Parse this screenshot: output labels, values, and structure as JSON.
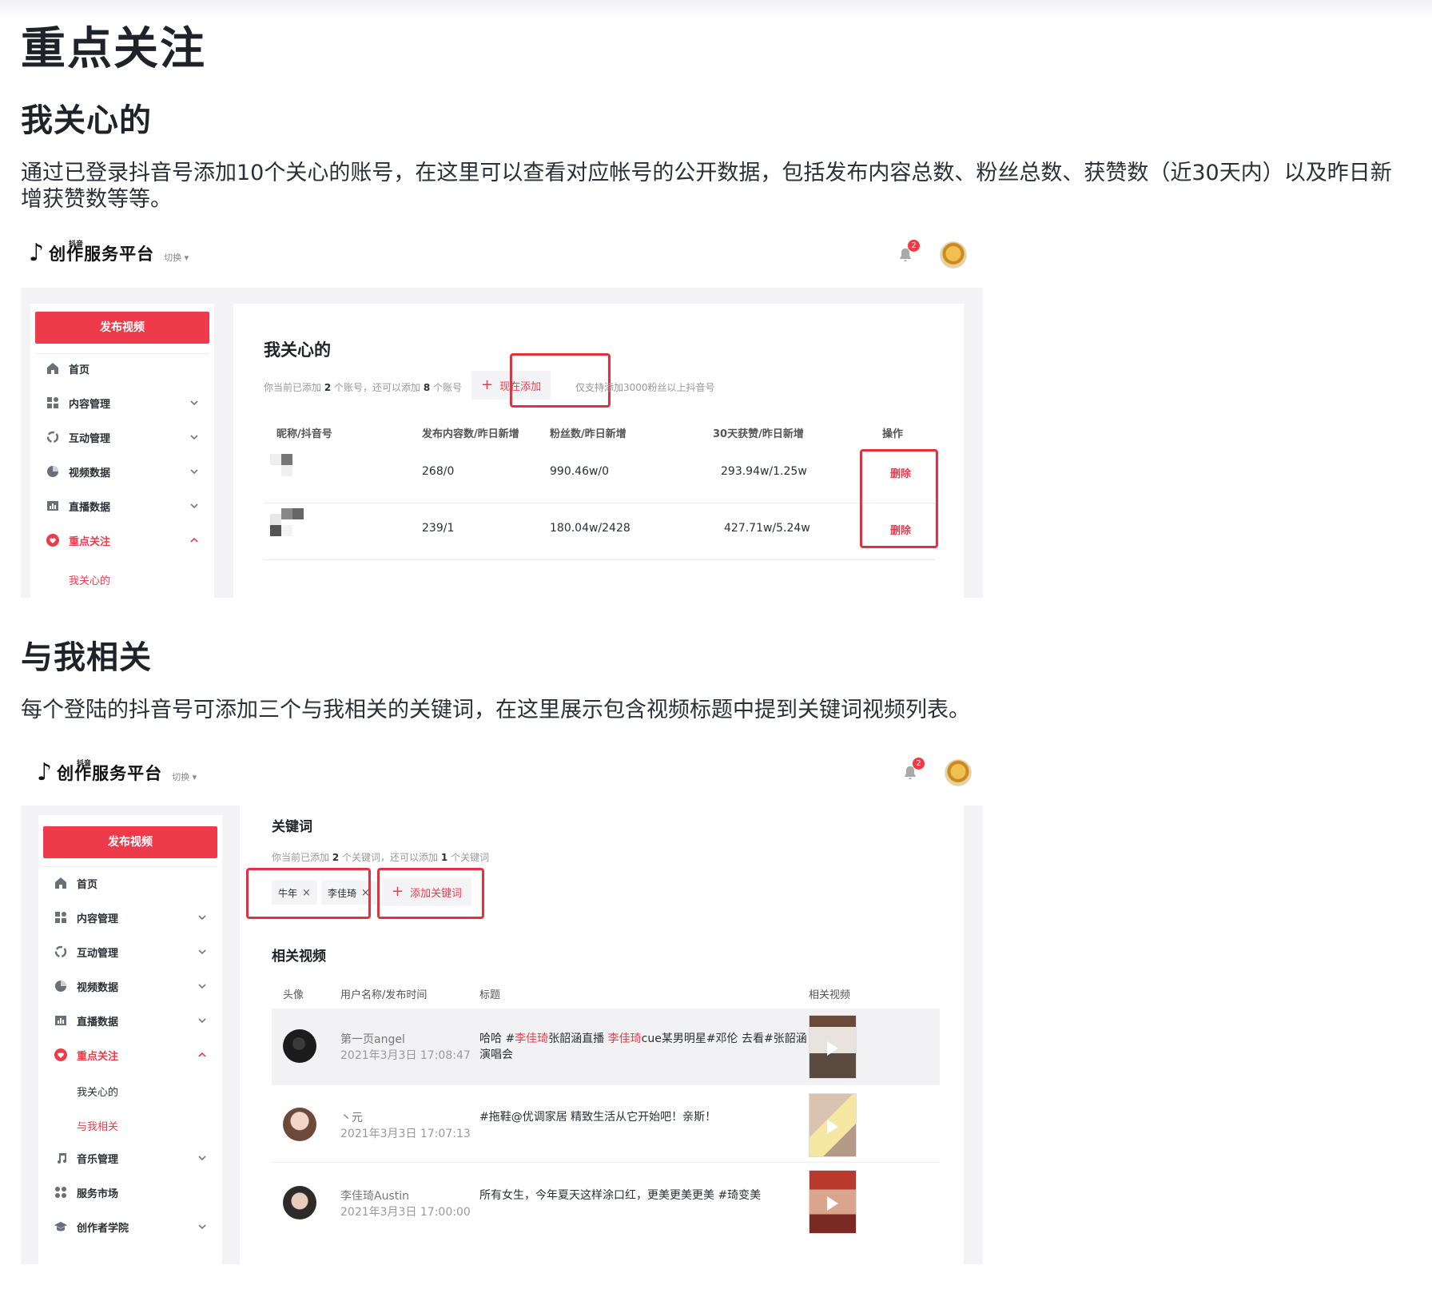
{
  "page": {
    "title": "重点关注",
    "section1": {
      "heading": "我关心的",
      "paragraph": "通过已登录抖音号添加10个关心的账号，在这里可以查看对应帐号的公开数据，包括发布内容总数、粉丝总数、获赞数（近30天内）以及昨日新增获赞数等等。"
    },
    "section2": {
      "heading": "与我相关",
      "paragraph": "每个登陆的抖音号可添加三个与我相关的关键词，在这里展示包含视频标题中提到关键词视频列表。"
    }
  },
  "app": {
    "brand_small": "抖音",
    "brand_title": "创作服务平台",
    "switch_label": "切换",
    "notification_count": "2",
    "publish_label": "发布视频"
  },
  "nav": {
    "home": "首页",
    "content": "内容管理",
    "interaction": "互动管理",
    "video_data": "视频数据",
    "live_data": "直播数据",
    "focus": "重点关注",
    "sub_mine": "我关心的",
    "sub_related": "与我相关",
    "music": "音乐管理",
    "market": "服务市场",
    "academy": "创作者学院"
  },
  "care": {
    "title": "我关心的",
    "hint_pre": "你当前已添加",
    "added": "2",
    "hint_mid": "个账号，还可以添加",
    "remaining": "8",
    "hint_post": "个账号",
    "add_label": "现在添加",
    "note": "仅支持添加3000粉丝以上抖音号",
    "columns": [
      "昵称/抖音号",
      "发布内容数/昨日新增",
      "粉丝数/昨日新增",
      "30天获赞/昨日新增",
      "操作"
    ],
    "rows": [
      {
        "posts": "268/0",
        "fans": "990.46w/0",
        "likes": "293.94w/1.25w",
        "action": "删除"
      },
      {
        "posts": "239/1",
        "fans": "180.04w/2428",
        "likes": "427.71w/5.24w",
        "action": "删除"
      }
    ]
  },
  "keywords": {
    "title": "关键词",
    "hint_pre": "你当前已添加",
    "added": "2",
    "hint_mid": "个关键词，还可以添加",
    "remaining": "1",
    "hint_post": "个关键词",
    "tags": [
      "牛年",
      "李佳琦"
    ],
    "add_label": "添加关键词",
    "videos_title": "相关视频",
    "columns": [
      "头像",
      "用户名称/发布时间",
      "标题",
      "相关视频"
    ],
    "rows": [
      {
        "user": "第一页angel",
        "time": "2021年3月3日 17:08:47",
        "t1": "哈哈 #",
        "t2": "李佳琦",
        "t3": "张韶涵直播 ",
        "t4": "李佳琦",
        "t5": "cue某男明星#邓伦 去看#张韶涵 演唱会"
      },
      {
        "user": "丶元",
        "time": "2021年3月3日 17:07:13",
        "title": "#拖鞋@优调家居 精致生活从它开始吧！亲斯！"
      },
      {
        "user": "李佳琦Austin",
        "time": "2021年3月3日 17:00:00",
        "title": "所有女生，今年夏天这样涂口红，更美更美更美 #琦变美"
      }
    ]
  },
  "colors": {
    "accent": "#ee3b4c",
    "highlight_box": "#e3323f"
  }
}
